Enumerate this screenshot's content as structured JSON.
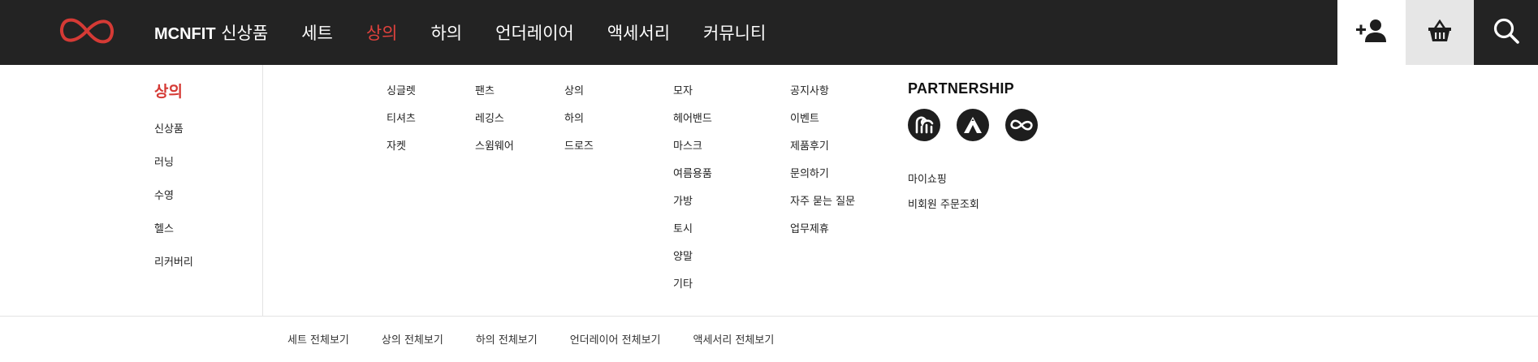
{
  "header": {
    "logo_icon": "infinity-logo-icon",
    "brand_en": "MCNFIT",
    "brand_ko": "신상품",
    "nav": [
      {
        "label": "세트"
      },
      {
        "label": "상의",
        "active": true
      },
      {
        "label": "하의"
      },
      {
        "label": "언더레이어"
      },
      {
        "label": "액세서리"
      },
      {
        "label": "커뮤니티"
      }
    ],
    "icons": {
      "join": "add-user-icon",
      "cart": "basket-icon",
      "search": "search-icon"
    },
    "colors": {
      "bar": "#232323",
      "accent": "#e0423d"
    }
  },
  "menu": {
    "title": "상의",
    "left_items": [
      "신상품",
      "러닝",
      "수영",
      "헬스",
      "리커버리"
    ],
    "set_items": [
      "싱글렛",
      "티셔츠",
      "자켓"
    ],
    "bottom_items": [
      "팬츠",
      "레깅스",
      "스윔웨어"
    ],
    "underlayer_items": [
      "상의",
      "하의",
      "드로즈"
    ],
    "accessory_items": [
      "모자",
      "헤어밴드",
      "마스크",
      "여름용품",
      "가방",
      "토시",
      "양말",
      "기타"
    ],
    "community_items": [
      "공지사항",
      "이벤트",
      "제품후기",
      "문의하기",
      "자주 묻는 질문",
      "업무제휴"
    ],
    "partnership": {
      "title": "PARTNERSHIP",
      "logos": [
        "wave-logo-icon",
        "mountain-logo-icon",
        "infinity-logo-icon"
      ],
      "links": [
        "마이쇼핑",
        "비회원 주문조회"
      ]
    }
  },
  "footer_links": [
    "세트 전체보기",
    "상의 전체보기",
    "하의 전체보기",
    "언더레이어 전체보기",
    "액세서리 전체보기"
  ]
}
